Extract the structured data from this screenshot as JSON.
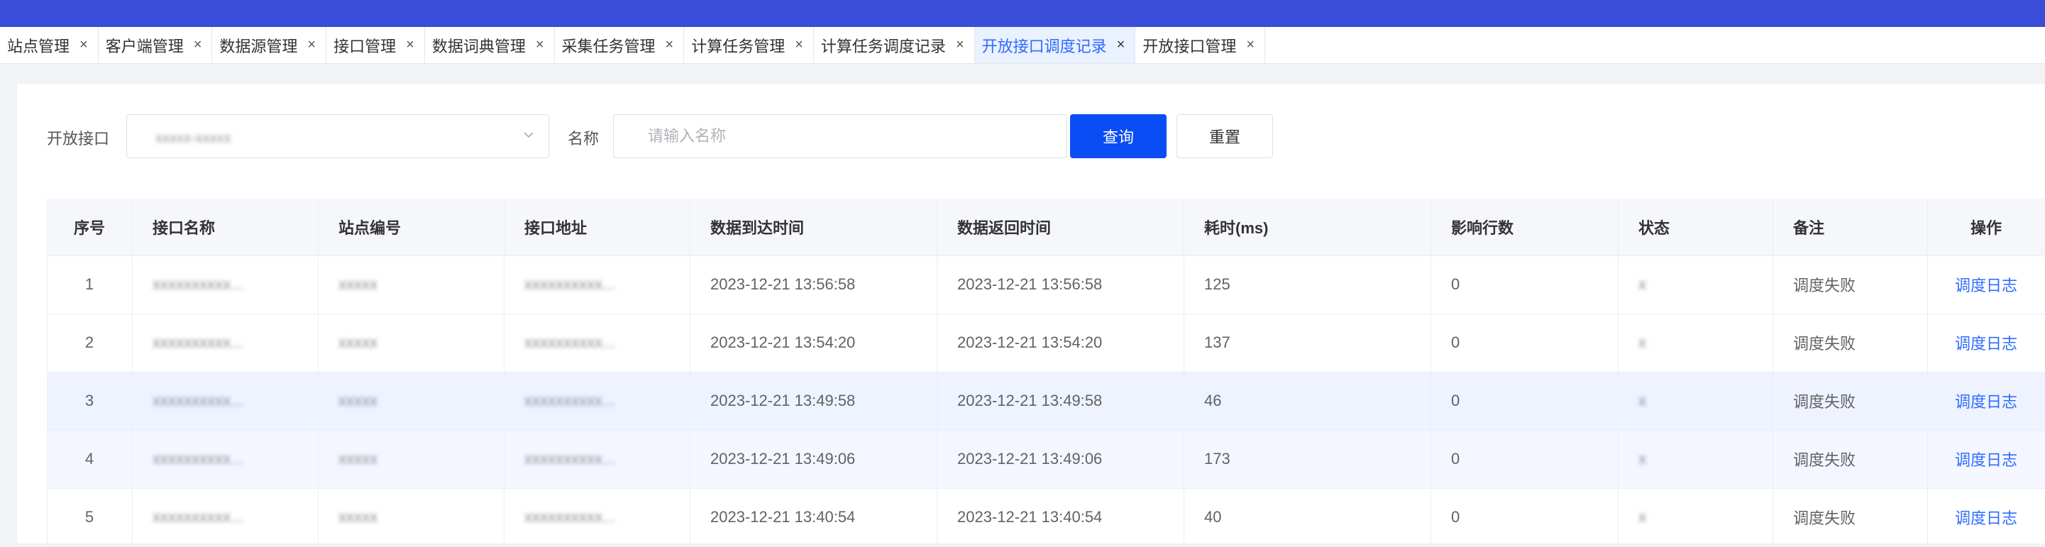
{
  "tabs": [
    {
      "label": "站点管理",
      "active": false
    },
    {
      "label": "客户端管理",
      "active": false
    },
    {
      "label": "数据源管理",
      "active": false
    },
    {
      "label": "接口管理",
      "active": false
    },
    {
      "label": "数据词典管理",
      "active": false
    },
    {
      "label": "采集任务管理",
      "active": false
    },
    {
      "label": "计算任务管理",
      "active": false
    },
    {
      "label": "计算任务调度记录",
      "active": false
    },
    {
      "label": "开放接口调度记录",
      "active": true
    },
    {
      "label": "开放接口管理",
      "active": false
    }
  ],
  "tab_close_glyph": "×",
  "filters": {
    "open_api_label": "开放接口",
    "open_api_value": "xxxxx-xxxxx",
    "name_label": "名称",
    "name_placeholder": "请输入名称",
    "name_value": "",
    "query_button": "查询",
    "reset_button": "重置"
  },
  "table": {
    "columns": [
      "序号",
      "接口名称",
      "站点编号",
      "接口地址",
      "数据到达时间",
      "数据返回时间",
      "耗时(ms)",
      "影响行数",
      "状态",
      "备注",
      "操作"
    ],
    "rows": [
      {
        "index": "1",
        "api_name": "xxxxxxxxxx...",
        "site_code": "xxxxx",
        "api_url": "xxxxxxxxxx...",
        "arrive_time": "2023-12-21 13:56:58",
        "return_time": "2023-12-21 13:56:58",
        "cost_ms": "125",
        "affected_rows": "0",
        "status": "x",
        "remark": "调度失败",
        "action": "调度日志"
      },
      {
        "index": "2",
        "api_name": "xxxxxxxxxx...",
        "site_code": "xxxxx",
        "api_url": "xxxxxxxxxx...",
        "arrive_time": "2023-12-21 13:54:20",
        "return_time": "2023-12-21 13:54:20",
        "cost_ms": "137",
        "affected_rows": "0",
        "status": "x",
        "remark": "调度失败",
        "action": "调度日志"
      },
      {
        "index": "3",
        "api_name": "xxxxxxxxxx...",
        "site_code": "xxxxx",
        "api_url": "xxxxxxxxxx...",
        "arrive_time": "2023-12-21 13:49:58",
        "return_time": "2023-12-21 13:49:58",
        "cost_ms": "46",
        "affected_rows": "0",
        "status": "x",
        "remark": "调度失败",
        "action": "调度日志"
      },
      {
        "index": "4",
        "api_name": "xxxxxxxxxx...",
        "site_code": "xxxxx",
        "api_url": "xxxxxxxxxx...",
        "arrive_time": "2023-12-21 13:49:06",
        "return_time": "2023-12-21 13:49:06",
        "cost_ms": "173",
        "affected_rows": "0",
        "status": "x",
        "remark": "调度失败",
        "action": "调度日志"
      },
      {
        "index": "5",
        "api_name": "xxxxxxxxxx...",
        "site_code": "xxxxx",
        "api_url": "xxxxxxxxxx...",
        "arrive_time": "2023-12-21 13:40:54",
        "return_time": "2023-12-21 13:40:54",
        "cost_ms": "40",
        "affected_rows": "0",
        "status": "x",
        "remark": "调度失败",
        "action": "调度日志"
      }
    ]
  },
  "colors": {
    "topbar": "#3a4dd8",
    "primary": "#0b4df5",
    "link": "#2f6bff",
    "active_tab_bg": "#eaf1ff"
  }
}
